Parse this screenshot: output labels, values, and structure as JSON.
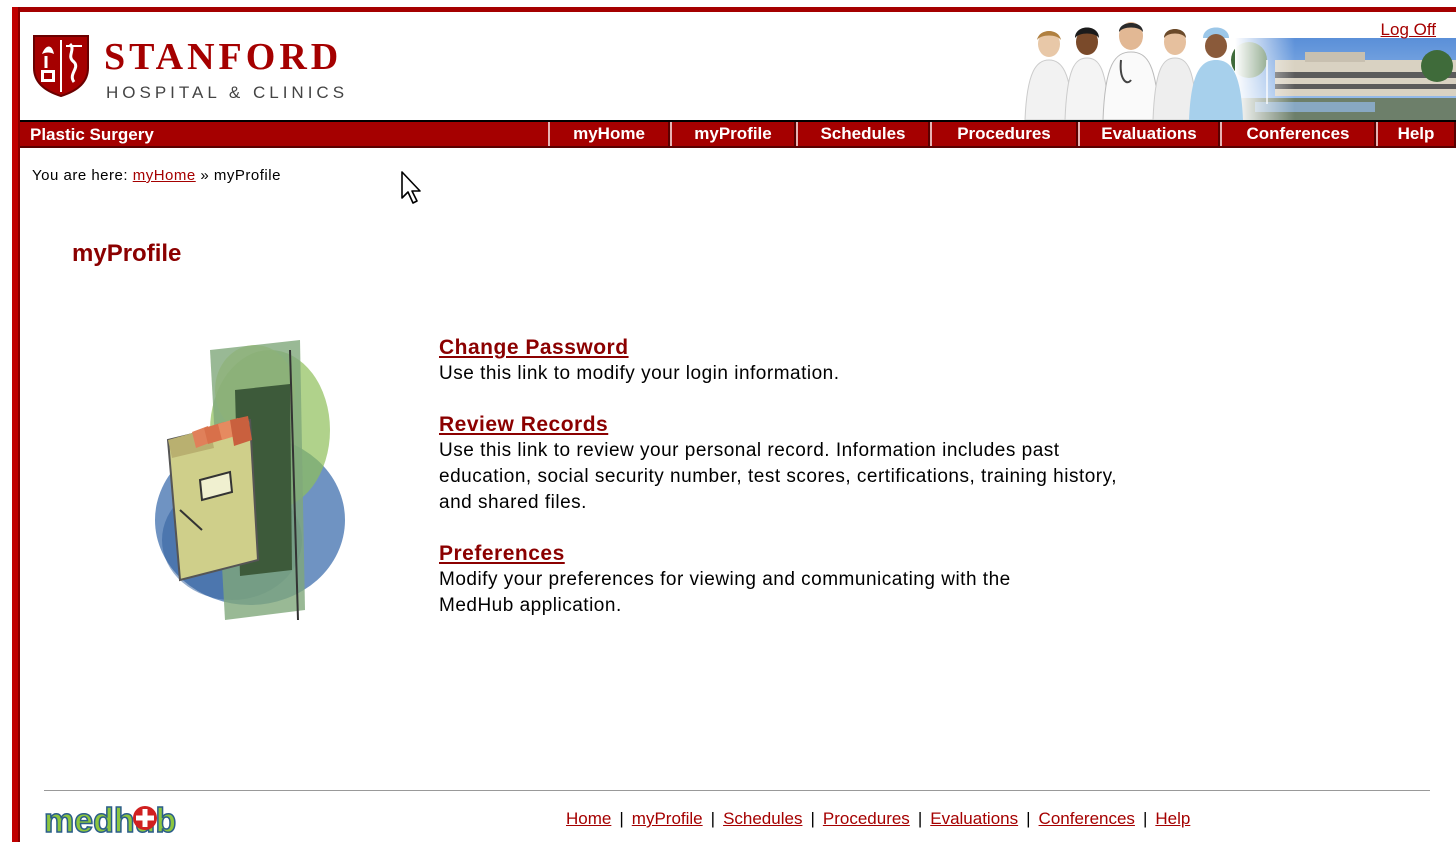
{
  "header": {
    "logo_name": "STANFORD",
    "logo_subtitle": "HOSPITAL & CLINICS",
    "logoff_label": "Log Off"
  },
  "nav": {
    "section_title": "Plastic Surgery",
    "tabs": [
      {
        "label": "myHome"
      },
      {
        "label": "myProfile"
      },
      {
        "label": "Schedules"
      },
      {
        "label": "Procedures"
      },
      {
        "label": "Evaluations"
      },
      {
        "label": "Conferences"
      },
      {
        "label": "Help"
      }
    ]
  },
  "breadcrumb": {
    "prefix": "You are here:",
    "home_link": "myHome",
    "separator": "»",
    "current": "myProfile"
  },
  "page": {
    "title": "myProfile",
    "links": [
      {
        "title": "Change Password",
        "description": "Use this link to modify your login information."
      },
      {
        "title": "Review Records",
        "description": "Use this link to review your personal record. Information includes past education, social security number, test scores, certifications, training history, and shared files."
      },
      {
        "title": "Preferences",
        "description": "Modify your preferences for viewing and communicating with the MedHub application."
      }
    ]
  },
  "footer": {
    "brand": "medhub",
    "links": [
      "Home",
      "myProfile",
      "Schedules",
      "Procedures",
      "Evaluations",
      "Conferences",
      "Help"
    ],
    "separator": "|"
  },
  "colors": {
    "brand_red": "#a50000",
    "title_red": "#8b0000",
    "nav_text": "#ffffff"
  }
}
